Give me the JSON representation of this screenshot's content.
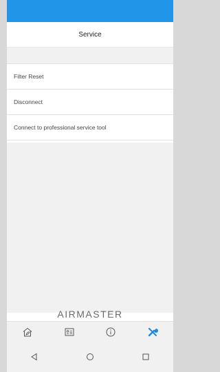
{
  "header": {
    "title": "Service"
  },
  "menu": {
    "items": [
      {
        "label": "Filter Reset"
      },
      {
        "label": "Disconnect"
      },
      {
        "label": "Connect to professional service tool"
      }
    ]
  },
  "brand": {
    "text": "AIRMASTER"
  },
  "tabs": [
    {
      "icon": "home-icon"
    },
    {
      "icon": "contact-card-icon"
    },
    {
      "icon": "info-icon"
    },
    {
      "icon": "wrench-screwdriver-icon",
      "active": true
    }
  ],
  "system_nav": [
    "back-icon",
    "home-circle-icon",
    "recents-icon"
  ],
  "colors": {
    "statusbar": "#2196e8",
    "active_tab": "#1e88e5",
    "inactive_tab": "#555555"
  }
}
